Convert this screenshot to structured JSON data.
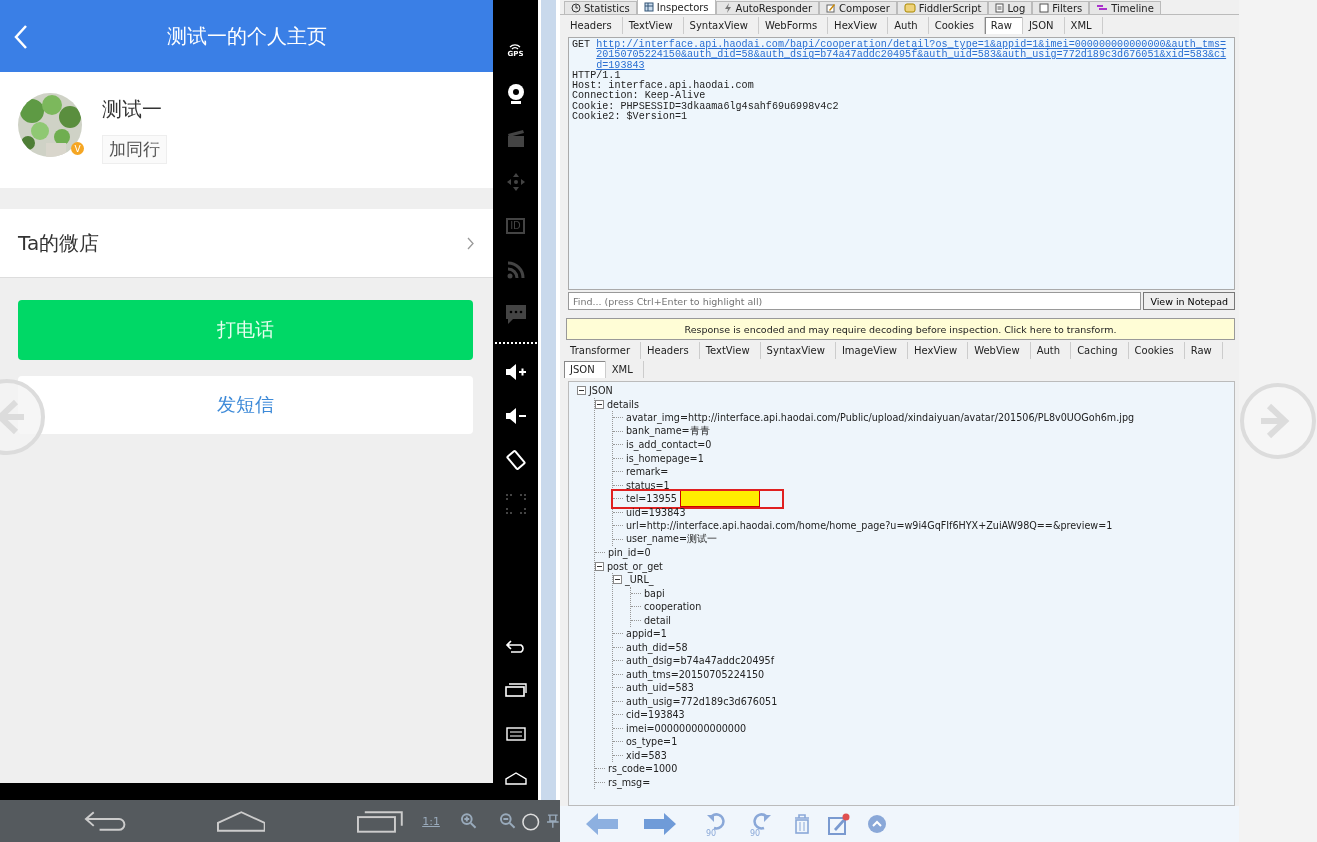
{
  "phone": {
    "title": "测试一的个人主页",
    "profile": {
      "name": "测试一",
      "badge": "V",
      "add_button": "加同行"
    },
    "shop_row": {
      "label": "Ta的微店"
    },
    "buttons": [
      {
        "kind": "primary",
        "label": "打电话"
      },
      {
        "kind": "secondary",
        "label": "发短信"
      }
    ]
  },
  "emulator_sidebar": {
    "gps_label": "GPS",
    "id_label": "ID"
  },
  "viewer_bar": {
    "scale_label": "1:1"
  },
  "fiddler": {
    "top_tabs": [
      {
        "label": "Statistics",
        "selected": false
      },
      {
        "label": "Inspectors",
        "selected": true
      },
      {
        "label": "AutoResponder",
        "selected": false
      },
      {
        "label": "Composer",
        "selected": false
      },
      {
        "label": "FiddlerScript",
        "selected": false
      },
      {
        "label": "Log",
        "selected": false
      },
      {
        "label": "Filters",
        "selected": false
      },
      {
        "label": "Timeline",
        "selected": false
      }
    ],
    "request_tabs": [
      {
        "label": "Headers",
        "selected": false
      },
      {
        "label": "TextView",
        "selected": false
      },
      {
        "label": "SyntaxView",
        "selected": false
      },
      {
        "label": "WebForms",
        "selected": false
      },
      {
        "label": "HexView",
        "selected": false
      },
      {
        "label": "Auth",
        "selected": false
      },
      {
        "label": "Cookies",
        "selected": false
      },
      {
        "label": "Raw",
        "selected": true
      },
      {
        "label": "JSON",
        "selected": false
      },
      {
        "label": "XML",
        "selected": false
      }
    ],
    "request": {
      "method": "GET",
      "url": "http://interface.api.haodai.com/bapi/cooperation/detail?os_type=1&appid=1&imei=000000000000000&auth_tms=20150705224150&auth_did=58&auth_dsig=b74a47addc20495f&auth_uid=583&auth_usig=772d189c3d676051&xid=583&cid=193843",
      "version": "HTTP/1.1",
      "headers": [
        "Host: interface.api.haodai.com",
        "Connection: Keep-Alive",
        "Cookie: PHPSESSID=3dkaama6lg4sahf69u6998v4c2",
        "Cookie2: $Version=1"
      ]
    },
    "find": {
      "placeholder": "Find... (press Ctrl+Enter to highlight all)",
      "button": "View in Notepad"
    },
    "banner": "Response is encoded and may require decoding before inspection. Click here to transform.",
    "response_tabs": [
      {
        "label": "Transformer",
        "selected": false
      },
      {
        "label": "Headers",
        "selected": false
      },
      {
        "label": "TextView",
        "selected": false
      },
      {
        "label": "SyntaxView",
        "selected": false
      },
      {
        "label": "ImageView",
        "selected": false
      },
      {
        "label": "HexView",
        "selected": false
      },
      {
        "label": "WebView",
        "selected": false
      },
      {
        "label": "Auth",
        "selected": false
      },
      {
        "label": "Caching",
        "selected": false
      },
      {
        "label": "Cookies",
        "selected": false
      },
      {
        "label": "Raw",
        "selected": false
      },
      {
        "label": "JSON",
        "selected": true
      },
      {
        "label": "XML",
        "selected": false
      }
    ],
    "tree": [
      {
        "label": "JSON",
        "expanded": true,
        "children": [
          {
            "label": "details",
            "expanded": true,
            "children": [
              {
                "label": "avatar_img=http://interface.api.haodai.com/Public/upload/xindaiyuan/avatar/201506/PL8v0UOGoh6m.jpg"
              },
              {
                "label": "bank_name=青青"
              },
              {
                "label": "is_add_contact=0"
              },
              {
                "label": "is_homepage=1"
              },
              {
                "label": "remark="
              },
              {
                "label": "status=1"
              },
              {
                "label": "tel=13955",
                "redacted": true
              },
              {
                "label": "uid=193843"
              },
              {
                "label": "url=http://interface.api.haodai.com/home/home_page?u=w9i4GqFIf6HYX+ZuiAW98Q==&preview=1"
              },
              {
                "label": "user_name=测试一"
              }
            ]
          },
          {
            "label": "pin_id=0"
          },
          {
            "label": "post_or_get",
            "expanded": true,
            "children": [
              {
                "label": "_URL_",
                "expanded": true,
                "children": [
                  {
                    "label": "bapi"
                  },
                  {
                    "label": "cooperation"
                  },
                  {
                    "label": "detail"
                  }
                ]
              },
              {
                "label": "appid=1"
              },
              {
                "label": "auth_did=58"
              },
              {
                "label": "auth_dsig=b74a47addc20495f"
              },
              {
                "label": "auth_tms=20150705224150"
              },
              {
                "label": "auth_uid=583"
              },
              {
                "label": "auth_usig=772d189c3d676051"
              },
              {
                "label": "cid=193843"
              },
              {
                "label": "imei=000000000000000"
              },
              {
                "label": "os_type=1"
              },
              {
                "label": "xid=583"
              }
            ]
          },
          {
            "label": "rs_code=1000"
          },
          {
            "label": "rs_msg="
          }
        ]
      }
    ]
  },
  "viewer_toolbar": {
    "rotate_left_label": "90",
    "rotate_right_label": "90"
  }
}
